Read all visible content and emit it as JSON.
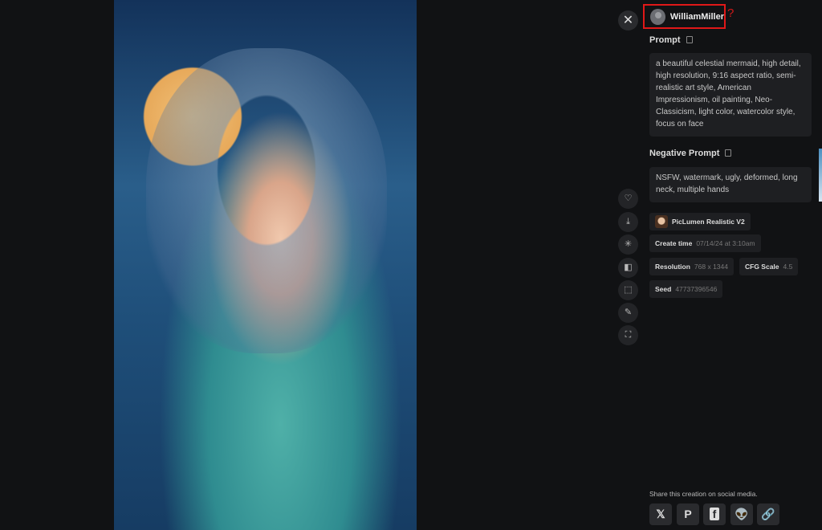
{
  "user": {
    "name": "WilliamMiller",
    "help_icon": "question-mark"
  },
  "prompt": {
    "label": "Prompt",
    "text": "a beautiful celestial mermaid, high detail, high resolution, 9:16 aspect ratio, semi-realistic art style, American Impressionism, oil painting, Neo-Classicism, light color, watercolor style, focus on face"
  },
  "negative_prompt": {
    "label": "Negative Prompt",
    "text": "NSFW, watermark, ugly, deformed, long neck, multiple hands"
  },
  "model": "PicLumen Realistic V2",
  "details": {
    "create_time": {
      "label": "Create time",
      "value": "07/14/24 at 3:10am"
    },
    "resolution": {
      "label": "Resolution",
      "value": "768 x 1344"
    },
    "cfg_scale": {
      "label": "CFG Scale",
      "value": "4.5"
    },
    "seed": {
      "label": "Seed",
      "value": "47737396546"
    }
  },
  "share": {
    "text": "Share this creation on social media.",
    "networks": [
      "X",
      "Pinterest",
      "Facebook",
      "Reddit",
      "Copy link"
    ]
  },
  "side_actions": [
    "like",
    "download",
    "vary",
    "compare",
    "upscale",
    "edit",
    "expand"
  ],
  "accent": "#e01818"
}
